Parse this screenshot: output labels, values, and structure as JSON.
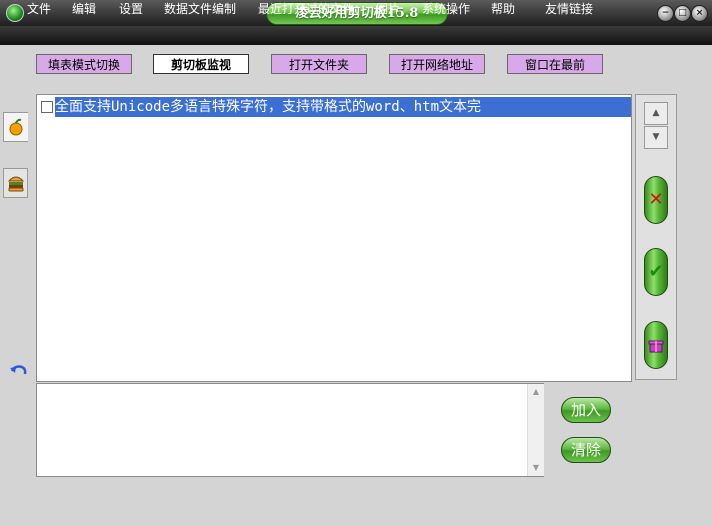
{
  "window": {
    "title": "凌云好用剪切板15.8",
    "controls": [
      "minimize",
      "restore",
      "close"
    ]
  },
  "menu": [
    "文件",
    "编辑",
    "设置",
    "数据文件编制",
    "最近打开过的文件",
    "图片",
    "系统操作",
    "帮助",
    "友情链接"
  ],
  "toolbar": [
    {
      "label": "填表模式切换",
      "active": false
    },
    {
      "label": "剪切板监视",
      "active": true
    },
    {
      "label": "打开文件夹",
      "active": false
    },
    {
      "label": "打开网络地址",
      "active": false
    },
    {
      "label": "窗口在最前",
      "active": false
    }
  ],
  "side_tabs": [
    "orange-icon",
    "burger-icon"
  ],
  "list": {
    "items": [
      {
        "text": "全面支持Unicode多语言特殊字符，支持带格式的word、htm文本完",
        "checked": false,
        "selected": true
      }
    ]
  },
  "right_panel": {
    "buttons": [
      "delete-x-icon",
      "confirm-check-icon",
      "gift-icon"
    ]
  },
  "input": {
    "value": "",
    "add_label": "加入",
    "clear_label": "清除"
  },
  "colors": {
    "selection": "#3b6fd4",
    "accent_green": "#5ab83a",
    "toolbar_purple": "#d8a8e8"
  }
}
